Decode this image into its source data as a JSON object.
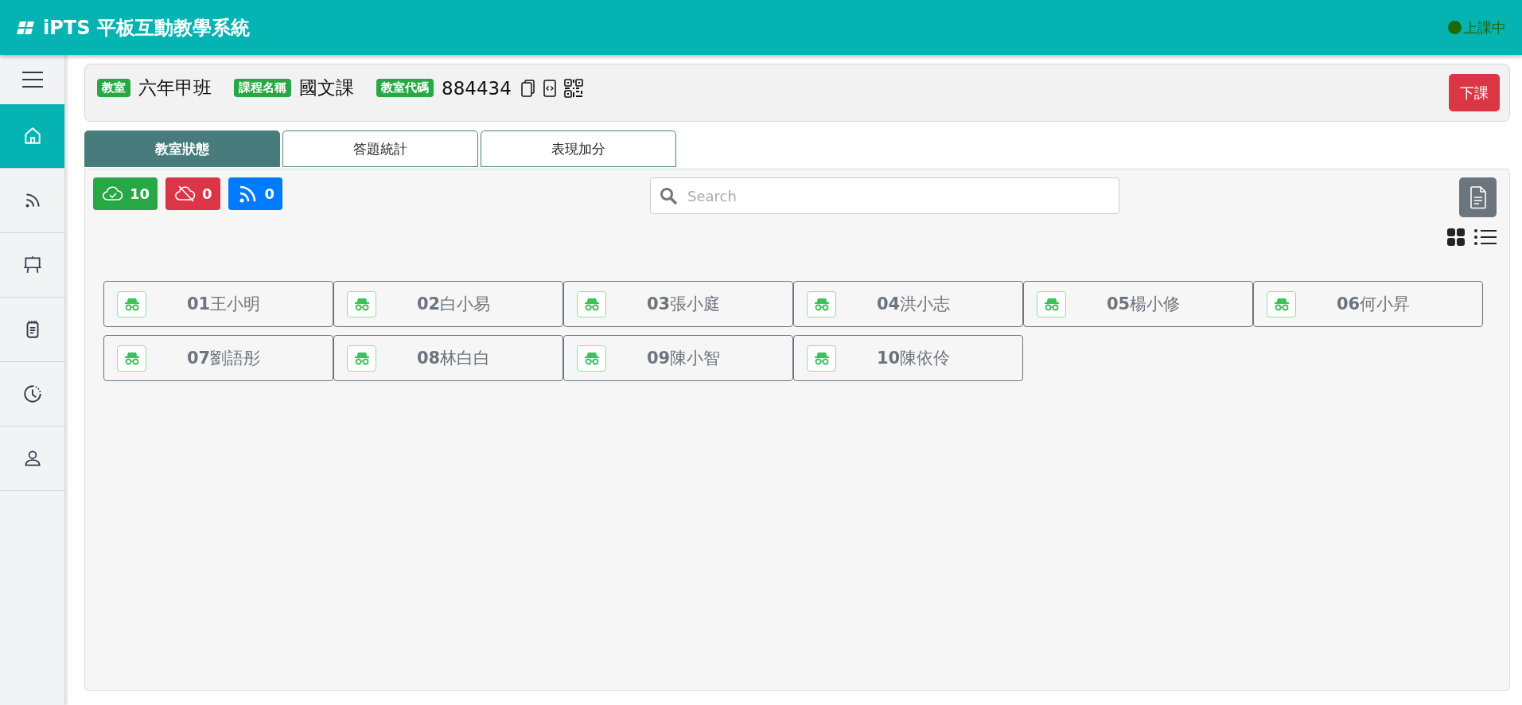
{
  "app": {
    "title": "iPTS 平板互動教學系統",
    "status": "上課中"
  },
  "sidebar": {
    "items": [
      {
        "kind": "home",
        "selected": true
      },
      {
        "kind": "broadcast",
        "selected": false
      },
      {
        "kind": "easel",
        "selected": false
      },
      {
        "kind": "notepad",
        "selected": false
      },
      {
        "kind": "history",
        "selected": false
      },
      {
        "kind": "user",
        "selected": false
      }
    ]
  },
  "classroom": {
    "fields": [
      {
        "label": "教室",
        "value": "六年甲班"
      },
      {
        "label": "課程名稱",
        "value": "國文課"
      },
      {
        "label": "教室代碼",
        "value": "884434"
      }
    ],
    "end_button": "下課"
  },
  "tabs": [
    {
      "label": "教室狀態",
      "selected": true
    },
    {
      "label": "答題統計",
      "selected": false
    },
    {
      "label": "表現加分",
      "selected": false
    }
  ],
  "counters": [
    {
      "kind": "online",
      "count": "10",
      "color": "#28a745"
    },
    {
      "kind": "offline",
      "count": "0",
      "color": "#dc3545"
    },
    {
      "kind": "broadcast",
      "count": "0",
      "color": "#007bff"
    }
  ],
  "search": {
    "placeholder": "Search"
  },
  "students": [
    {
      "number": "01",
      "name": "王小明"
    },
    {
      "number": "02",
      "name": "白小易"
    },
    {
      "number": "03",
      "name": "張小庭"
    },
    {
      "number": "04",
      "name": "洪小志"
    },
    {
      "number": "05",
      "name": "楊小修"
    },
    {
      "number": "06",
      "name": "何小昇"
    },
    {
      "number": "07",
      "name": "劉語彤"
    },
    {
      "number": "08",
      "name": "林白白"
    },
    {
      "number": "09",
      "name": "陳小智"
    },
    {
      "number": "10",
      "name": "陳依伶"
    }
  ]
}
